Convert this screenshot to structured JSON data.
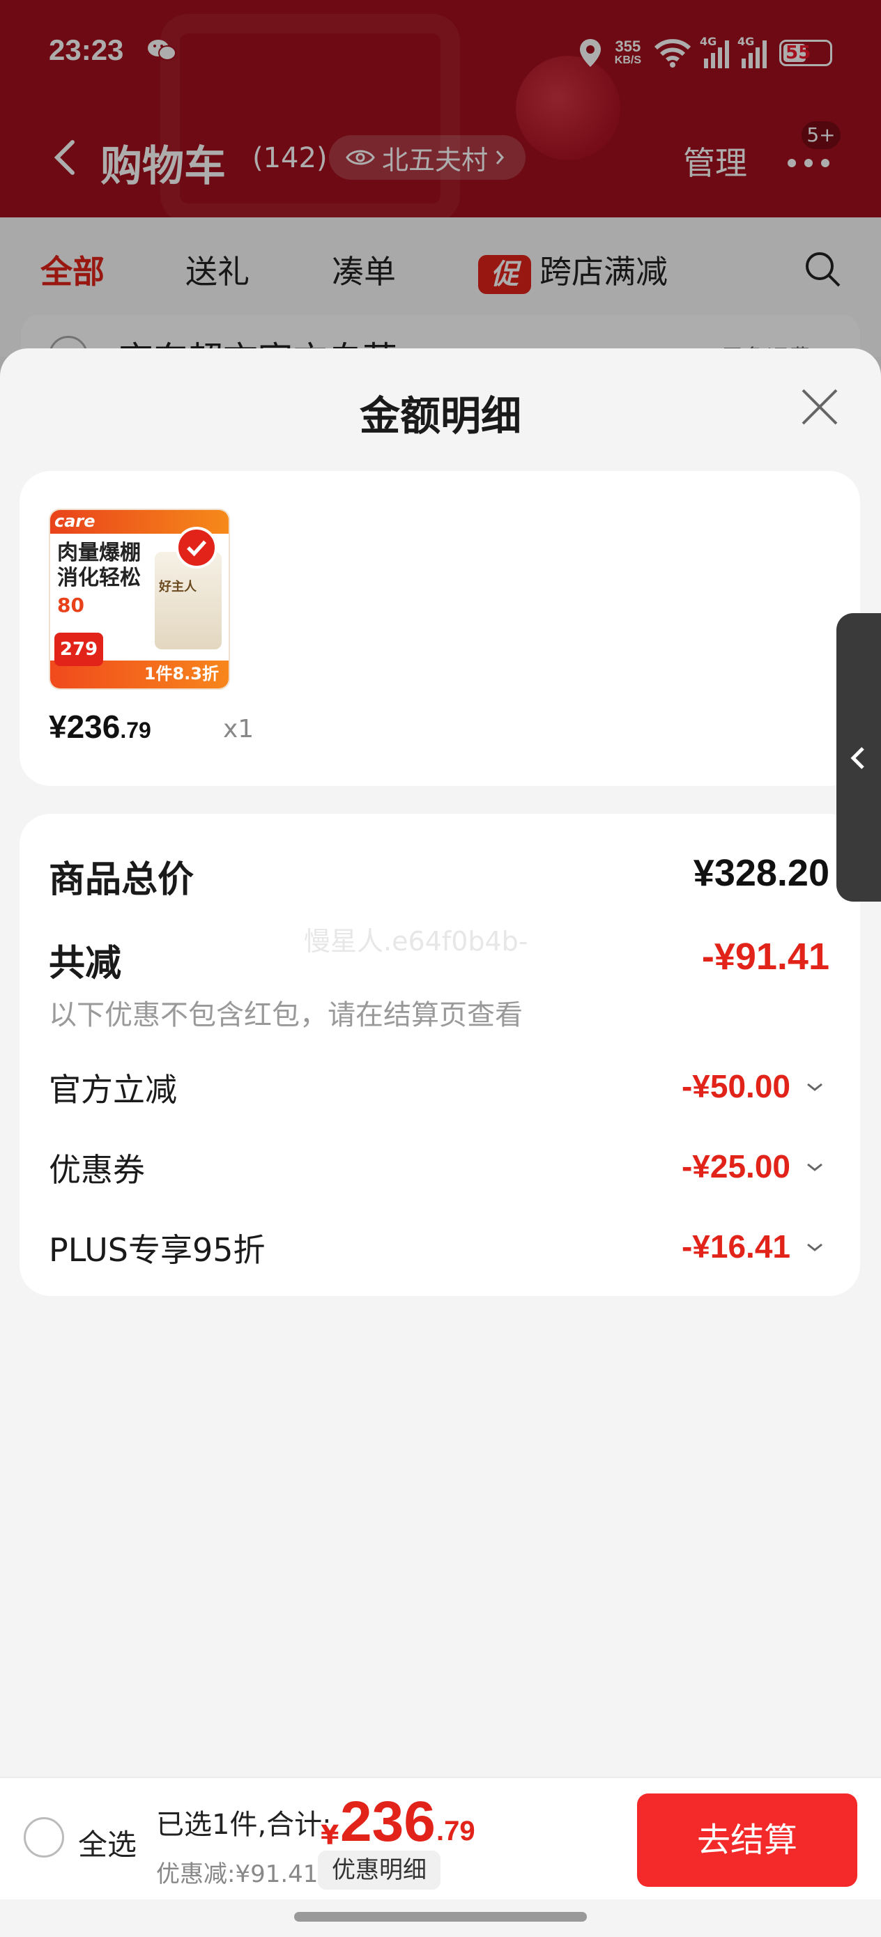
{
  "status_bar": {
    "time": "23:23",
    "speed_value": "355",
    "speed_unit": "KB/S",
    "signal1_label": "4G",
    "signal2_label": "4G",
    "battery": "55"
  },
  "header": {
    "title": "购物车",
    "count": "(142)",
    "location": "北五夫村",
    "manage": "管理",
    "more_badge": "5+"
  },
  "tabs": [
    {
      "label": "全部"
    },
    {
      "label": "送礼"
    },
    {
      "label": "凑单"
    },
    {
      "label": "跨店满减",
      "promo_tag": "促"
    }
  ],
  "store": {
    "name": "京东超市官方自营",
    "shipping": "已免运费"
  },
  "sheet": {
    "title": "金额明细",
    "product": {
      "thumb_brand": "care",
      "thumb_headline": "肉量爆棚 消化轻松",
      "thumb_percent": "80",
      "thumb_price_tag": "279",
      "thumb_deal": "1件8.3折",
      "thumb_bag_text": "好主人",
      "price_int": "¥236",
      "price_dec": ".79",
      "qty": "x1"
    },
    "rows": {
      "total_label": "商品总价",
      "total_value": "¥328.20",
      "reduce_label": "共减",
      "reduce_value": "-¥91.41",
      "reduce_note": "以下优惠不包含红包，请在结算页查看",
      "items": [
        {
          "label": "官方立减",
          "value": "-¥50.00"
        },
        {
          "label": "优惠券",
          "value": "-¥25.00"
        },
        {
          "label": "PLUS专享95折",
          "value": "-¥16.41"
        }
      ]
    },
    "watermark": "慢星人.e64f0b4b-"
  },
  "bottom_bar": {
    "select_all": "全选",
    "summary": "已选1件,合计:",
    "currency": "¥",
    "total_int": "236",
    "total_dec": ".79",
    "discount": "优惠减:¥91.41",
    "detail_button": "优惠明细",
    "checkout": "去结算"
  },
  "colors": {
    "brand_red": "#e2231a",
    "header_red": "#a30f1c",
    "checkout_red": "#f42a2a"
  }
}
